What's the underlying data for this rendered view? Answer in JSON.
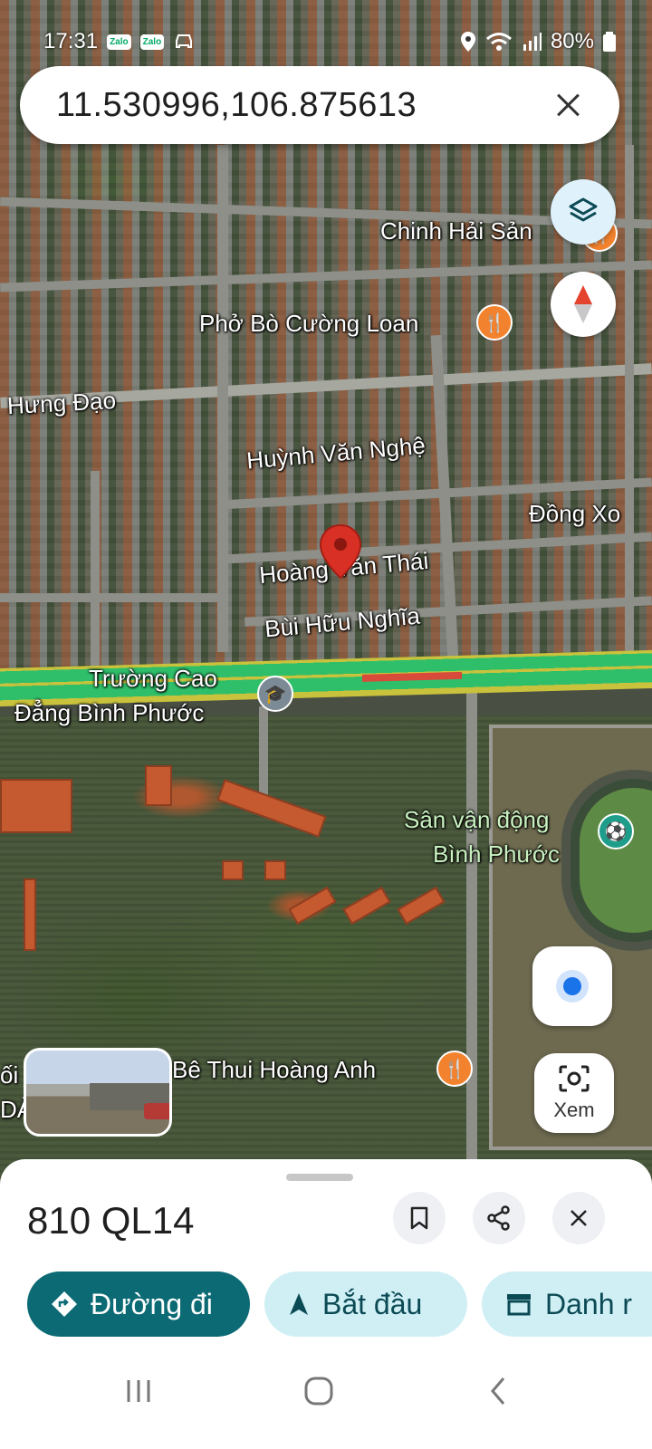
{
  "status_bar": {
    "time": "17:31",
    "notification_icons": [
      "Zalo",
      "Zalo"
    ],
    "battery": "80%"
  },
  "search": {
    "value": "11.530996,106.875613"
  },
  "map": {
    "labels": {
      "chinh_hai_san": "Chinh Hải Sản",
      "pho_bo": "Phở Bò Cường Loan",
      "hung_dao": "Hưng Đạo",
      "huynh_van_nghe": "Huỳnh Văn Nghệ",
      "dong_xoai": "Đồng Xo",
      "hoang_van_thai": "Hoàng Văn Thái",
      "bui_huu_nghia": "Bùi Hữu Nghĩa",
      "truong_cao_1": "Trường Cao",
      "truong_cao_2": "Đẳng Bình Phước",
      "san_van_dong_1": "Sân vận động",
      "san_van_dong_2": "Bình Phước",
      "be_thui": "Bê Thui Hoàng Anh",
      "edge_left_1": "ối",
      "edge_left_2": "DÀ"
    },
    "view_button_label": "Xem",
    "colors": {
      "highway_green": "#2fbf6a",
      "highway_yellow": "#c9c23c",
      "traffic_red": "#d84a3a",
      "poi_orange": "#f2822d",
      "pin_red": "#d93025"
    }
  },
  "place": {
    "title": "810 QL14",
    "actions": {
      "directions": "Đường đi",
      "start": "Bắt đầu",
      "list": "Danh r"
    }
  },
  "icons": {
    "layers": "layers-icon",
    "compass": "compass-icon",
    "location": "my-location-icon",
    "lens": "lens-icon",
    "bookmark": "bookmark-icon",
    "share": "share-icon",
    "close": "close-icon"
  }
}
